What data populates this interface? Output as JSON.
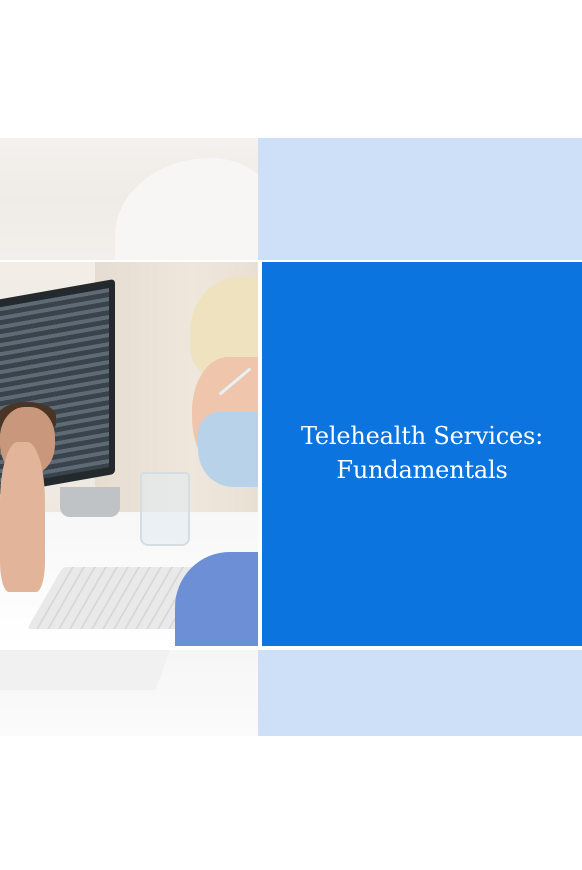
{
  "cover": {
    "title_line_1": "Telehealth Services:",
    "title_line_2": "Fundamentals"
  },
  "photo": {
    "icon": "telehealth-video-call-photo"
  },
  "colors": {
    "primary_blue": "#0b74df",
    "light_blue": "#cde0f7",
    "background": "#ffffff",
    "title_text": "#ffffff"
  }
}
